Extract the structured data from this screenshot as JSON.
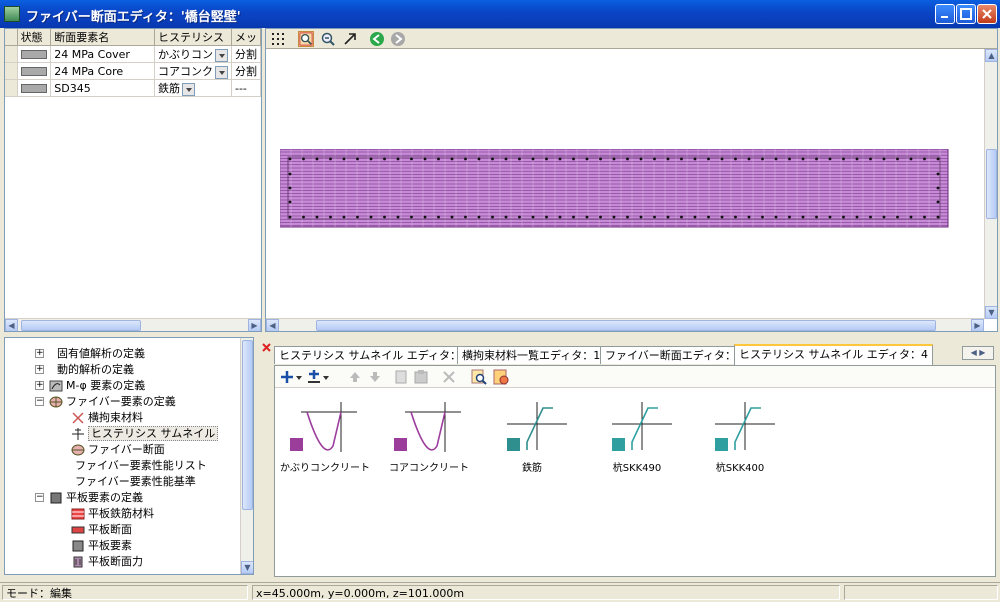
{
  "window": {
    "title": "ファイバー断面エディタ：'橋台竪壁'",
    "icon": "app-icon"
  },
  "section_table": {
    "headers": [
      "状態",
      "断面要素名",
      "ヒステリシス",
      "メッ"
    ],
    "rows": [
      {
        "name": "24 MPa Cover",
        "hysteresis": "かぶりコン",
        "mesh": "分割"
      },
      {
        "name": "24 MPa Core",
        "hysteresis": "コアコンク",
        "mesh": "分割"
      },
      {
        "name": "SD345",
        "hysteresis": "鉄筋",
        "mesh": "---"
      }
    ]
  },
  "view_toolbar": {
    "icons": [
      "grid-icon",
      "zoom-fit-icon",
      "zoom-out-icon",
      "pointer-arrow-icon",
      "back-icon",
      "forward-icon"
    ]
  },
  "tree": {
    "items": [
      {
        "label": "固有値解析の定義",
        "expander": "+"
      },
      {
        "label": "動的解析の定義",
        "expander": "+"
      },
      {
        "label": "M-φ 要素の定義",
        "expander": "+"
      },
      {
        "label": "ファイバー要素の定義",
        "expander": "−"
      },
      {
        "label": "横拘束材料"
      },
      {
        "label": "ヒステリシス サムネイル"
      },
      {
        "label": "ファイバー断面"
      },
      {
        "label": "ファイバー要素性能リスト"
      },
      {
        "label": "ファイバー要素性能基準"
      },
      {
        "label": "平板要素の定義",
        "expander": "−"
      },
      {
        "label": "平板鉄筋材料"
      },
      {
        "label": "平板断面"
      },
      {
        "label": "平板要素"
      },
      {
        "label": "平板断面力"
      }
    ]
  },
  "tabs": [
    {
      "label": "ヒステリシス サムネイル エディタ：3"
    },
    {
      "label": "横拘束材料一覧エディタ：1"
    },
    {
      "label": "ファイバー断面エディタ：4"
    },
    {
      "label": "ヒステリシス サムネイル エディタ：4",
      "active": true
    }
  ],
  "thumbnails": [
    {
      "label": "かぶりコンクリート",
      "color": "#9b3d9b",
      "kind": "concrete-cover"
    },
    {
      "label": "コアコンクリート",
      "color": "#9b3d9b",
      "kind": "concrete-core"
    },
    {
      "label": "鉄筋",
      "color": "#2f8f8f",
      "kind": "steel"
    },
    {
      "label": "杭SKK490",
      "color": "#2f9f9f",
      "kind": "steel"
    },
    {
      "label": "杭SKK400",
      "color": "#2f9f9f",
      "kind": "steel"
    }
  ],
  "status": {
    "mode": "モード：編集",
    "coords": "x=45.000m, y=0.000m, z=101.000m"
  },
  "colors": {
    "section_fill": "#c68ad6",
    "section_line": "#6a2a7a"
  }
}
